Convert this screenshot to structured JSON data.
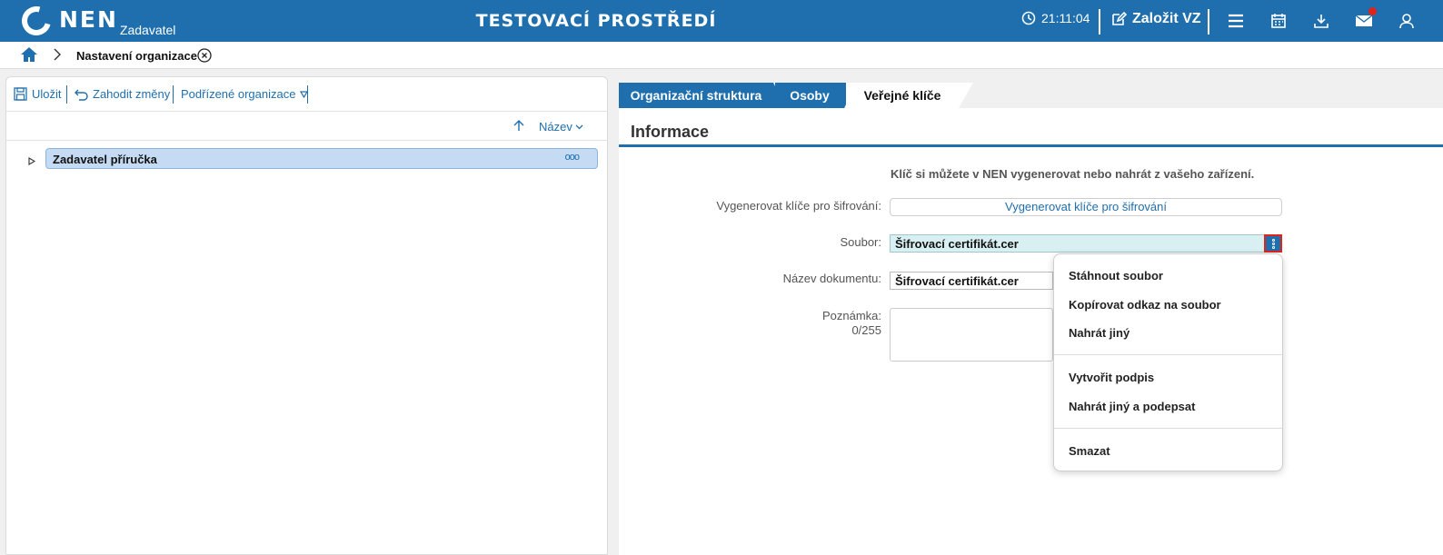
{
  "header": {
    "logo_text": "NEN",
    "logo_sub": "Zadavatel",
    "env_title": "TESTOVACÍ PROSTŘEDÍ",
    "clock": "21:11:04",
    "create_vz": "Založit VZ",
    "accent_color": "#1f6fae",
    "notification_dot_color": "#e2231a"
  },
  "breadcrumb": {
    "current": "Nastavení organizace"
  },
  "left_panel": {
    "toolbar": {
      "save": "Uložit",
      "discard": "Zahodit změny",
      "sub_orgs": "Podřízené organizace"
    },
    "sort": {
      "label": "Název"
    },
    "tree": {
      "node_label": "Zadavatel příručka",
      "node_menu": "ooo"
    }
  },
  "right_panel": {
    "tabs": [
      {
        "label": "Organizační struktura"
      },
      {
        "label": "Osoby"
      },
      {
        "label": "Veřejné klíče"
      }
    ],
    "active_tab": "Veřejné klíče",
    "section_title": "Informace",
    "info_text": "Klíč si můžete v NEN vygenerovat nebo nahrát z vašeho zařízení.",
    "form": {
      "generate_label": "Vygenerovat klíče pro šifrování:",
      "generate_button": "Vygenerovat klíče pro šifrování",
      "file_label": "Soubor:",
      "file_value": "Šifrovací certifikát.cer",
      "docname_label": "Název dokumentu:",
      "docname_value": "Šifrovací certifikát.cer",
      "note_label": "Poznámka:",
      "note_counter": "0/255"
    }
  },
  "dropdown": {
    "items": [
      "Stáhnout soubor",
      "Kopírovat odkaz na soubor",
      "Nahrát jiný",
      "Vytvořit podpis",
      "Nahrát jiný a podepsat",
      "Smazat"
    ]
  }
}
